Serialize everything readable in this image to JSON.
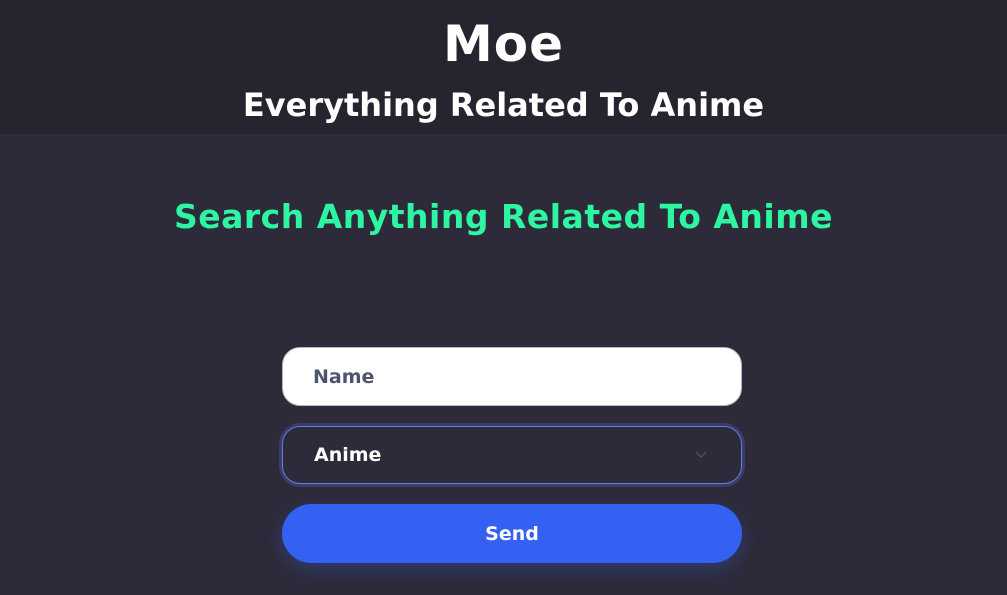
{
  "header": {
    "brand": "Moe",
    "tagline": "Everything Related To Anime"
  },
  "search": {
    "heading": "Search Anything Related To Anime",
    "name_placeholder": "Name",
    "category_selected": "Anime",
    "send_label": "Send"
  },
  "colors": {
    "header_bg": "#25242f",
    "page_bg": "#2d2b3a",
    "accent_green": "#2ef5a2",
    "button_blue": "#3461f2"
  },
  "icons": {
    "select_chevron": "chevron-down-icon"
  }
}
